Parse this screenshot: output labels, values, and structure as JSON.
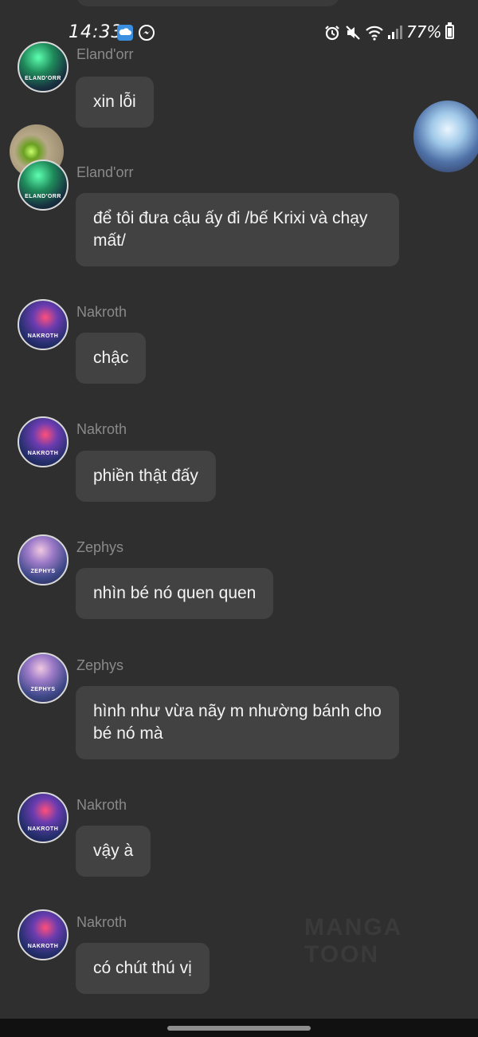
{
  "status_bar": {
    "time": "14:33",
    "battery": "77%",
    "battery_level": 0.77
  },
  "messages": [
    {
      "sender": "Eland'orr",
      "avatar_caption": "ELAND'ORR",
      "text": "xin lỗi"
    },
    {
      "sender": "Eland'orr",
      "avatar_caption": "ELAND'ORR",
      "text": "để tôi đưa cậu ấy đi /bế Krixi và chạy mất/"
    },
    {
      "sender": "Nakroth",
      "avatar_caption": "NAKROTH",
      "text": "chậc"
    },
    {
      "sender": "Nakroth",
      "avatar_caption": "NAKROTH",
      "text": "phiền thật đấy"
    },
    {
      "sender": "Zephys",
      "avatar_caption": "ZEPHYS",
      "text": "nhìn bé nó quen quen"
    },
    {
      "sender": "Zephys",
      "avatar_caption": "ZEPHYS",
      "text": "hình như vừa nãy m nhường bánh cho bé nó mà"
    },
    {
      "sender": "Nakroth",
      "avatar_caption": "NAKROTH",
      "text": "vậy à"
    },
    {
      "sender": "Nakroth",
      "avatar_caption": "NAKROTH",
      "text": "có chút thú vị"
    }
  ],
  "watermark": "MANGA TOON"
}
